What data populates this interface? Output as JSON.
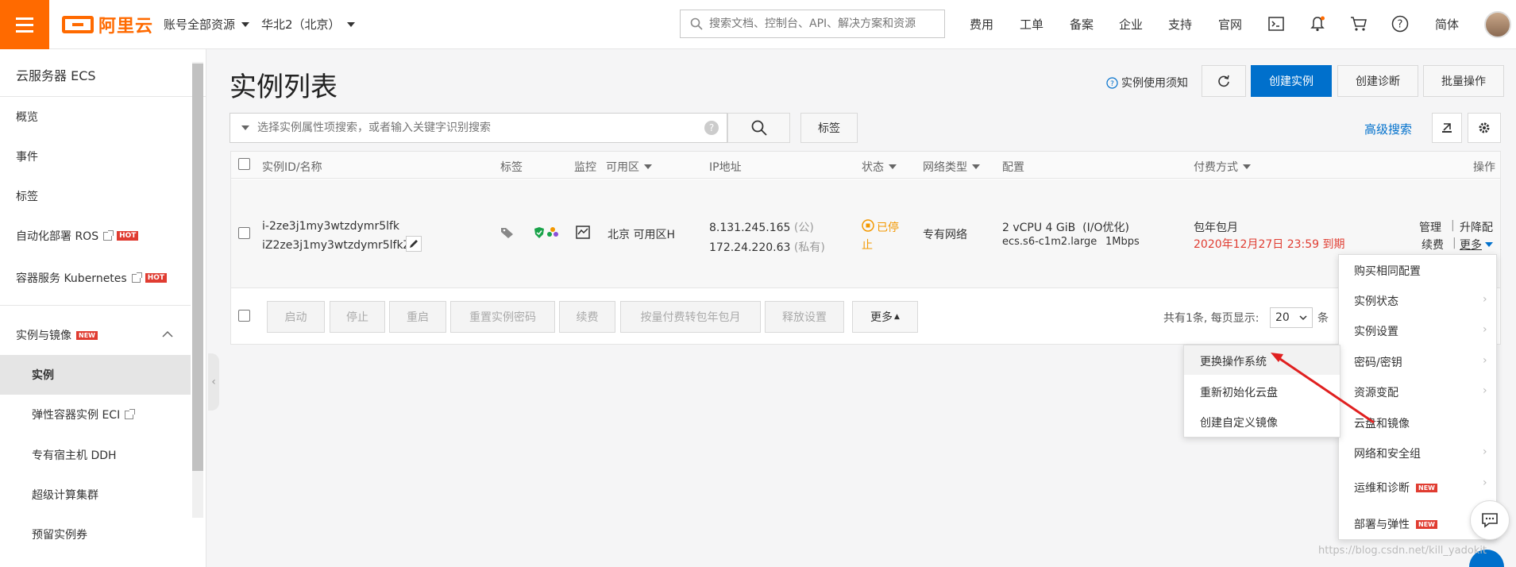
{
  "topbar": {
    "logo_text": "阿里云",
    "account_scope": "账号全部资源",
    "region": "华北2（北京）",
    "search_placeholder": "搜索文档、控制台、API、解决方案和资源",
    "nav": [
      "费用",
      "工单",
      "备案",
      "企业",
      "支持",
      "官网"
    ],
    "language": "简体"
  },
  "sidebar": {
    "title": "云服务器 ECS",
    "items": [
      {
        "label": "概览"
      },
      {
        "label": "事件"
      },
      {
        "label": "标签"
      },
      {
        "label": "自动化部署 ROS",
        "badge": "HOT"
      },
      {
        "label": "容器服务 Kubernetes",
        "badge": "HOT"
      }
    ],
    "group": {
      "label": "实例与镜像",
      "badge": "NEW"
    },
    "sub_items": [
      {
        "label": "实例"
      },
      {
        "label": "弹性容器实例 ECI"
      },
      {
        "label": "专有宿主机 DDH"
      },
      {
        "label": "超级计算集群"
      },
      {
        "label": "预留实例券"
      }
    ]
  },
  "header": {
    "title": "实例列表",
    "help_link": "实例使用须知",
    "create_button": "创建实例",
    "diagnose_button": "创建诊断",
    "batch_button": "批量操作",
    "advanced_search": "高级搜索"
  },
  "filter": {
    "placeholder": "选择实例属性项搜索，或者输入关键字识别搜索",
    "tag_button": "标签"
  },
  "table": {
    "columns": [
      "实例ID/名称",
      "标签",
      "监控",
      "可用区",
      "IP地址",
      "状态",
      "网络类型",
      "配置",
      "付费方式",
      "操作"
    ],
    "row": {
      "instance_id": "i-2ze3j1my3wtzdymr5lfk",
      "instance_name": "iZ2ze3j1my3wtzdymr5lfkZ",
      "zone": "北京 可用区H",
      "public_ip": "8.131.245.165",
      "public_label": "(公)",
      "private_ip": "172.24.220.63",
      "private_label": "(私有)",
      "status_line1": "已停",
      "status_line2": "止",
      "network": "专有网络",
      "config_line1": "2 vCPU 4 GiB",
      "config_opt": "(I/O优化)",
      "instance_type": "ecs.s6-c1m2.large",
      "bandwidth": "1Mbps",
      "billing": "包年包月",
      "expiry": "2020年12月27日 23:59 到期",
      "actions": {
        "manage": "管理",
        "upgrade": "升降配",
        "renew": "续费",
        "more": "更多"
      }
    }
  },
  "bulk": {
    "buttons": [
      "启动",
      "停止",
      "重启",
      "重置实例密码",
      "续费",
      "按量付费转包年包月",
      "释放设置"
    ],
    "more": "更多",
    "pagination_text": "共有1条, 每页显示:",
    "page_size": "20",
    "unit": "条"
  },
  "more_menu": {
    "items": [
      {
        "label": "购买相同配置",
        "arrow": false
      },
      {
        "label": "实例状态",
        "arrow": true
      },
      {
        "label": "实例设置",
        "arrow": true
      },
      {
        "label": "密码/密钥",
        "arrow": true
      },
      {
        "label": "资源变配",
        "arrow": true
      },
      {
        "label": "云盘和镜像",
        "arrow": false
      },
      {
        "label": "网络和安全组",
        "arrow": true
      },
      {
        "label": "运维和诊断",
        "badge": "NEW",
        "arrow": true
      },
      {
        "label": "部署与弹性",
        "badge": "NEW",
        "arrow": true
      }
    ]
  },
  "sub_menu": {
    "items": [
      "更换操作系统",
      "重新初始化云盘",
      "创建自定义镜像"
    ]
  },
  "watermark": "https://blog.csdn.net/kill_yadokit"
}
